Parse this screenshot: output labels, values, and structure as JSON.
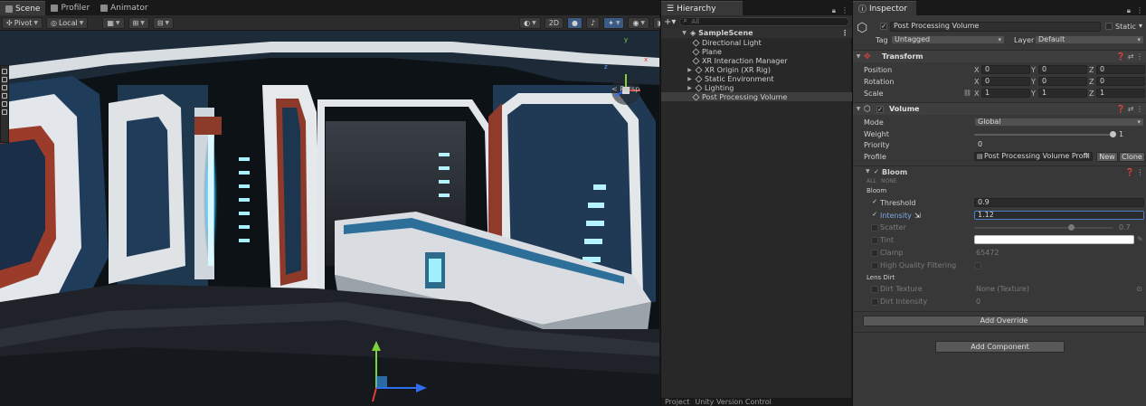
{
  "scene_panel": {
    "tabs": [
      {
        "label": "Scene",
        "icon": "scene-icon"
      },
      {
        "label": "Profiler",
        "icon": "profiler-icon"
      },
      {
        "label": "Animator",
        "icon": "animator-icon"
      }
    ],
    "toolbar": {
      "pivot": "Pivot",
      "local": "Local",
      "mode_2d": "2D"
    },
    "perspective_label": "< Persp",
    "gizmo_axes": {
      "y": "y",
      "x": "x",
      "z": "z"
    }
  },
  "hierarchy": {
    "tab": "Hierarchy",
    "search_placeholder": "All",
    "scene_name": "SampleScene",
    "items": [
      {
        "label": "Directional Light",
        "expandable": false,
        "selected": false
      },
      {
        "label": "Plane",
        "expandable": false,
        "selected": false
      },
      {
        "label": "XR Interaction Manager",
        "expandable": false,
        "selected": false
      },
      {
        "label": "XR Origin (XR Rig)",
        "expandable": true,
        "selected": false
      },
      {
        "label": "Static Environment",
        "expandable": true,
        "selected": false
      },
      {
        "label": "Lighting",
        "expandable": true,
        "selected": false
      },
      {
        "label": "Post Processing Volume",
        "expandable": false,
        "selected": true
      }
    ],
    "bottom_tabs": [
      "Project",
      "Unity Version Control"
    ]
  },
  "inspector": {
    "tab": "Inspector",
    "object_name": "Post Processing Volume",
    "static_label": "Static",
    "tag_label": "Tag",
    "tag_value": "Untagged",
    "layer_label": "Layer",
    "layer_value": "Default",
    "transform": {
      "title": "Transform",
      "rows": [
        {
          "label": "Position",
          "x": "0",
          "y": "0",
          "z": "0"
        },
        {
          "label": "Rotation",
          "x": "0",
          "y": "0",
          "z": "0"
        },
        {
          "label": "Scale",
          "x": "1",
          "y": "1",
          "z": "1"
        }
      ]
    },
    "volume": {
      "title": "Volume",
      "mode_label": "Mode",
      "mode_value": "Global",
      "weight_label": "Weight",
      "weight_value": "1",
      "weight_fraction": 1,
      "priority_label": "Priority",
      "priority_value": "0",
      "profile_label": "Profile",
      "profile_value": "Post Processing Volume Profil",
      "new_button": "New",
      "clone_button": "Clone"
    },
    "bloom": {
      "title": "Bloom",
      "all_label": "ALL",
      "none_label": "NONE",
      "section_bloom": "Bloom",
      "threshold_label": "Threshold",
      "threshold_value": "0.9",
      "intensity_label": "Intensity",
      "intensity_value": "1.12",
      "scatter_label": "Scatter",
      "scatter_value": "0.7",
      "scatter_fraction": 0.7,
      "tint_label": "Tint",
      "clamp_label": "Clamp",
      "clamp_value": "65472",
      "hq_label": "High Quality Filtering",
      "section_lens": "Lens Dirt",
      "dirt_texture_label": "Dirt Texture",
      "dirt_texture_value": "None (Texture)",
      "dirt_intensity_label": "Dirt Intensity",
      "dirt_intensity_value": "0"
    },
    "add_override": "Add Override",
    "add_component": "Add Component"
  },
  "colors": {
    "accent": "#3b5a86",
    "selection": "#3e3e3e",
    "panel": "#383838"
  }
}
